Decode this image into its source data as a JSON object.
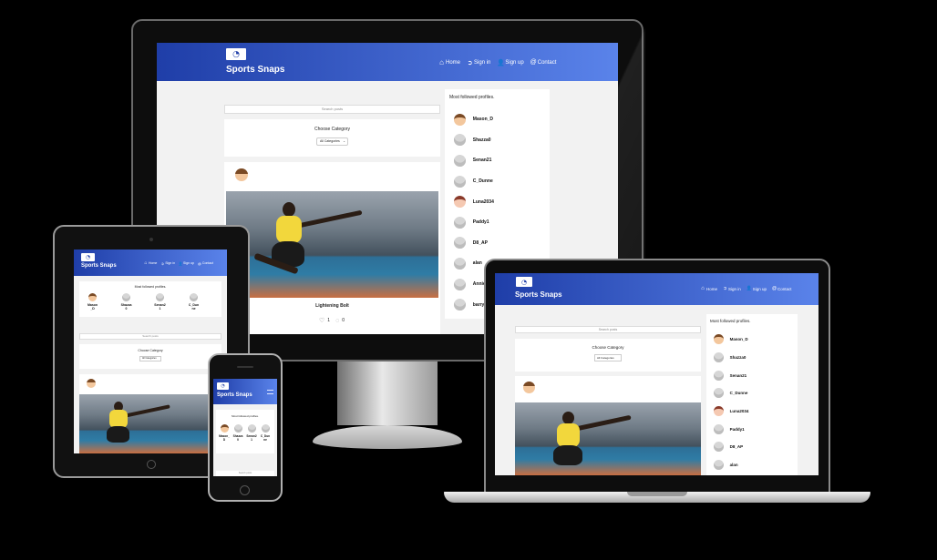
{
  "site": {
    "brand": "Sports Snaps",
    "nav": [
      {
        "icon": "home-icon",
        "label": "Home"
      },
      {
        "icon": "sign-in-icon",
        "label": "Sign in"
      },
      {
        "icon": "sign-up-icon",
        "label": "Sign up"
      },
      {
        "icon": "contact-icon",
        "label": "Contact"
      }
    ],
    "search_placeholder": "Search posts",
    "category": {
      "title": "Choose Category",
      "selected": "All Categories"
    },
    "sidebar_title": "Most followed profiles.",
    "profiles": [
      "Mason_D",
      "Shazza0",
      "Senan21",
      "C_Dunne",
      "Luna2034",
      "Paddy1",
      "D8_AP",
      "alan",
      "Annie",
      "barry"
    ],
    "post": {
      "title": "Lightening Bolt",
      "likes": "1",
      "comments": "0"
    }
  },
  "colors": {
    "nav_start": "#1f3ea8",
    "nav_end": "#5a83ea",
    "page_bg": "#f2f2f2"
  }
}
